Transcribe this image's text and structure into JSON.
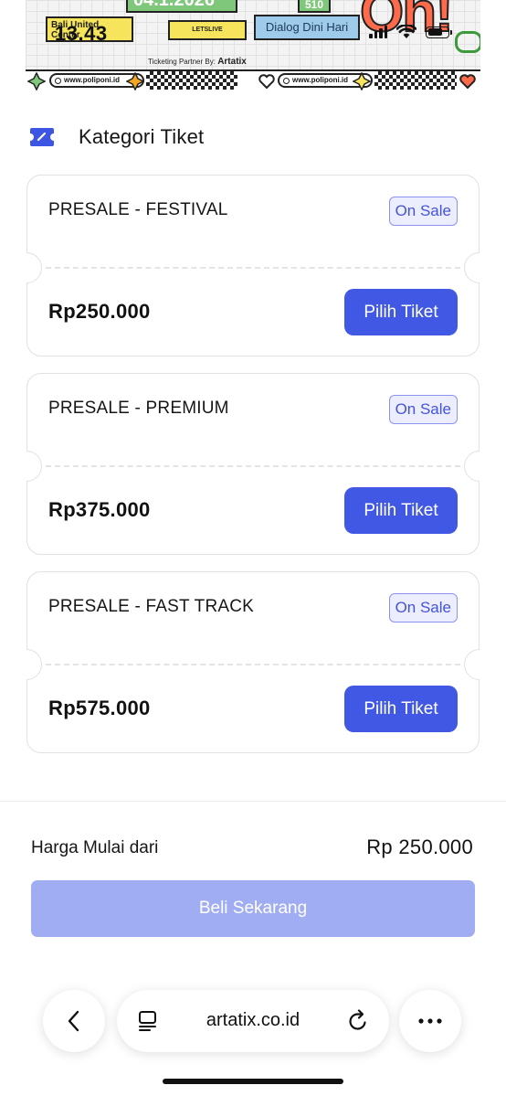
{
  "status_bar": {
    "time": "13.43"
  },
  "banner": {
    "date_partial": "04.1.2026",
    "venue_partial": "Bali United Center",
    "presenter": "LETSLIVE",
    "number_sticker": "510",
    "blue_sticker": "Dialog Dini Hari",
    "oh_sticker": "Oh!",
    "partner_prefix": "Ticketing Partner By:",
    "partner_name": "Artatix",
    "url_chip": "www.poliponi.id"
  },
  "section": {
    "title": "Kategori Tiket"
  },
  "tickets": [
    {
      "name": "PRESALE - FESTIVAL",
      "status": "On Sale",
      "price": "Rp250.000",
      "button": "Pilih Tiket"
    },
    {
      "name": "PRESALE - PREMIUM",
      "status": "On Sale",
      "price": "Rp375.000",
      "button": "Pilih Tiket"
    },
    {
      "name": "PRESALE - FAST TRACK",
      "status": "On Sale",
      "price": "Rp575.000",
      "button": "Pilih Tiket"
    }
  ],
  "summary": {
    "from_label": "Harga Mulai dari",
    "from_value": "Rp 250.000",
    "buy_button": "Beli Sekarang"
  },
  "browser": {
    "url": "artatix.co.id",
    "icons": [
      "back-chevron-icon",
      "reader-icon",
      "reload-icon",
      "more-icon"
    ]
  },
  "colors": {
    "primary": "#4058e4",
    "primary_disabled": "#a1adf2",
    "badge_bg": "#eceefe",
    "badge_text": "#4553d8"
  }
}
